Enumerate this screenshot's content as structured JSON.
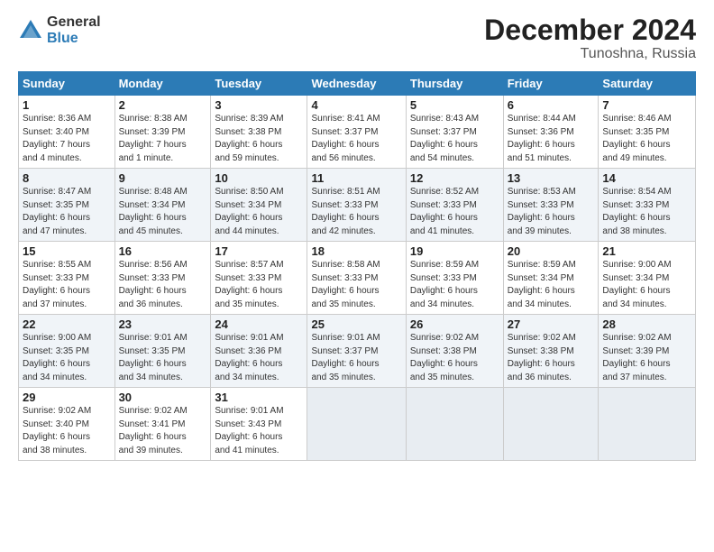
{
  "header": {
    "logo_general": "General",
    "logo_blue": "Blue",
    "title": "December 2024",
    "subtitle": "Tunoshna, Russia"
  },
  "days_of_week": [
    "Sunday",
    "Monday",
    "Tuesday",
    "Wednesday",
    "Thursday",
    "Friday",
    "Saturday"
  ],
  "weeks": [
    [
      {
        "day": "1",
        "info": "Sunrise: 8:36 AM\nSunset: 3:40 PM\nDaylight: 7 hours\nand 4 minutes."
      },
      {
        "day": "2",
        "info": "Sunrise: 8:38 AM\nSunset: 3:39 PM\nDaylight: 7 hours\nand 1 minute."
      },
      {
        "day": "3",
        "info": "Sunrise: 8:39 AM\nSunset: 3:38 PM\nDaylight: 6 hours\nand 59 minutes."
      },
      {
        "day": "4",
        "info": "Sunrise: 8:41 AM\nSunset: 3:37 PM\nDaylight: 6 hours\nand 56 minutes."
      },
      {
        "day": "5",
        "info": "Sunrise: 8:43 AM\nSunset: 3:37 PM\nDaylight: 6 hours\nand 54 minutes."
      },
      {
        "day": "6",
        "info": "Sunrise: 8:44 AM\nSunset: 3:36 PM\nDaylight: 6 hours\nand 51 minutes."
      },
      {
        "day": "7",
        "info": "Sunrise: 8:46 AM\nSunset: 3:35 PM\nDaylight: 6 hours\nand 49 minutes."
      }
    ],
    [
      {
        "day": "8",
        "info": "Sunrise: 8:47 AM\nSunset: 3:35 PM\nDaylight: 6 hours\nand 47 minutes."
      },
      {
        "day": "9",
        "info": "Sunrise: 8:48 AM\nSunset: 3:34 PM\nDaylight: 6 hours\nand 45 minutes."
      },
      {
        "day": "10",
        "info": "Sunrise: 8:50 AM\nSunset: 3:34 PM\nDaylight: 6 hours\nand 44 minutes."
      },
      {
        "day": "11",
        "info": "Sunrise: 8:51 AM\nSunset: 3:33 PM\nDaylight: 6 hours\nand 42 minutes."
      },
      {
        "day": "12",
        "info": "Sunrise: 8:52 AM\nSunset: 3:33 PM\nDaylight: 6 hours\nand 41 minutes."
      },
      {
        "day": "13",
        "info": "Sunrise: 8:53 AM\nSunset: 3:33 PM\nDaylight: 6 hours\nand 39 minutes."
      },
      {
        "day": "14",
        "info": "Sunrise: 8:54 AM\nSunset: 3:33 PM\nDaylight: 6 hours\nand 38 minutes."
      }
    ],
    [
      {
        "day": "15",
        "info": "Sunrise: 8:55 AM\nSunset: 3:33 PM\nDaylight: 6 hours\nand 37 minutes."
      },
      {
        "day": "16",
        "info": "Sunrise: 8:56 AM\nSunset: 3:33 PM\nDaylight: 6 hours\nand 36 minutes."
      },
      {
        "day": "17",
        "info": "Sunrise: 8:57 AM\nSunset: 3:33 PM\nDaylight: 6 hours\nand 35 minutes."
      },
      {
        "day": "18",
        "info": "Sunrise: 8:58 AM\nSunset: 3:33 PM\nDaylight: 6 hours\nand 35 minutes."
      },
      {
        "day": "19",
        "info": "Sunrise: 8:59 AM\nSunset: 3:33 PM\nDaylight: 6 hours\nand 34 minutes."
      },
      {
        "day": "20",
        "info": "Sunrise: 8:59 AM\nSunset: 3:34 PM\nDaylight: 6 hours\nand 34 minutes."
      },
      {
        "day": "21",
        "info": "Sunrise: 9:00 AM\nSunset: 3:34 PM\nDaylight: 6 hours\nand 34 minutes."
      }
    ],
    [
      {
        "day": "22",
        "info": "Sunrise: 9:00 AM\nSunset: 3:35 PM\nDaylight: 6 hours\nand 34 minutes."
      },
      {
        "day": "23",
        "info": "Sunrise: 9:01 AM\nSunset: 3:35 PM\nDaylight: 6 hours\nand 34 minutes."
      },
      {
        "day": "24",
        "info": "Sunrise: 9:01 AM\nSunset: 3:36 PM\nDaylight: 6 hours\nand 34 minutes."
      },
      {
        "day": "25",
        "info": "Sunrise: 9:01 AM\nSunset: 3:37 PM\nDaylight: 6 hours\nand 35 minutes."
      },
      {
        "day": "26",
        "info": "Sunrise: 9:02 AM\nSunset: 3:38 PM\nDaylight: 6 hours\nand 35 minutes."
      },
      {
        "day": "27",
        "info": "Sunrise: 9:02 AM\nSunset: 3:38 PM\nDaylight: 6 hours\nand 36 minutes."
      },
      {
        "day": "28",
        "info": "Sunrise: 9:02 AM\nSunset: 3:39 PM\nDaylight: 6 hours\nand 37 minutes."
      }
    ],
    [
      {
        "day": "29",
        "info": "Sunrise: 9:02 AM\nSunset: 3:40 PM\nDaylight: 6 hours\nand 38 minutes."
      },
      {
        "day": "30",
        "info": "Sunrise: 9:02 AM\nSunset: 3:41 PM\nDaylight: 6 hours\nand 39 minutes."
      },
      {
        "day": "31",
        "info": "Sunrise: 9:01 AM\nSunset: 3:43 PM\nDaylight: 6 hours\nand 41 minutes."
      },
      {
        "day": "",
        "info": ""
      },
      {
        "day": "",
        "info": ""
      },
      {
        "day": "",
        "info": ""
      },
      {
        "day": "",
        "info": ""
      }
    ]
  ]
}
